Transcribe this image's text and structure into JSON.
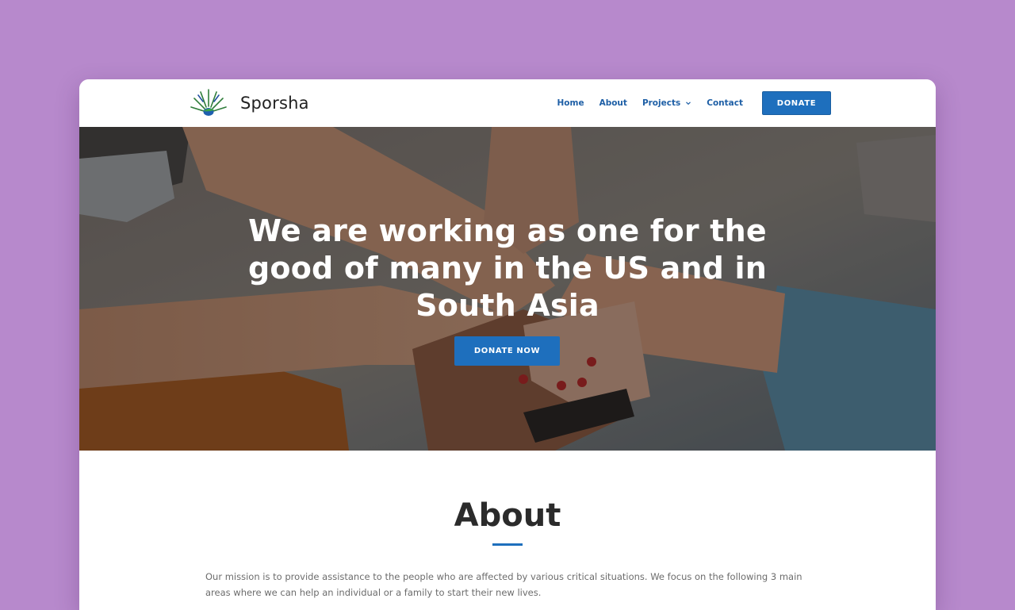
{
  "colors": {
    "page_background": "#b789cc",
    "accent": "#1e6fbd",
    "nav_text": "#1e5fa6",
    "heading_text": "#2b2b2b",
    "body_text": "#6c6c6c"
  },
  "header": {
    "logo_icon": "sun-rays-leaf-logo",
    "site_title": "Sporsha",
    "nav": {
      "home": "Home",
      "about": "About",
      "projects": "Projects",
      "contact": "Contact"
    },
    "projects_icon": "chevron-down-icon",
    "donate_label": "DONATE"
  },
  "hero": {
    "image_description_icon": "stacked-hands-photo",
    "title": "We are working as one for the good of many in the US and in South Asia",
    "cta_label": "DONATE NOW"
  },
  "about": {
    "title": "About",
    "text": "Our mission is to provide assistance to the people who are affected by various critical situations. We focus on the following 3 main areas where we can help an individual or a family to start their new lives."
  }
}
